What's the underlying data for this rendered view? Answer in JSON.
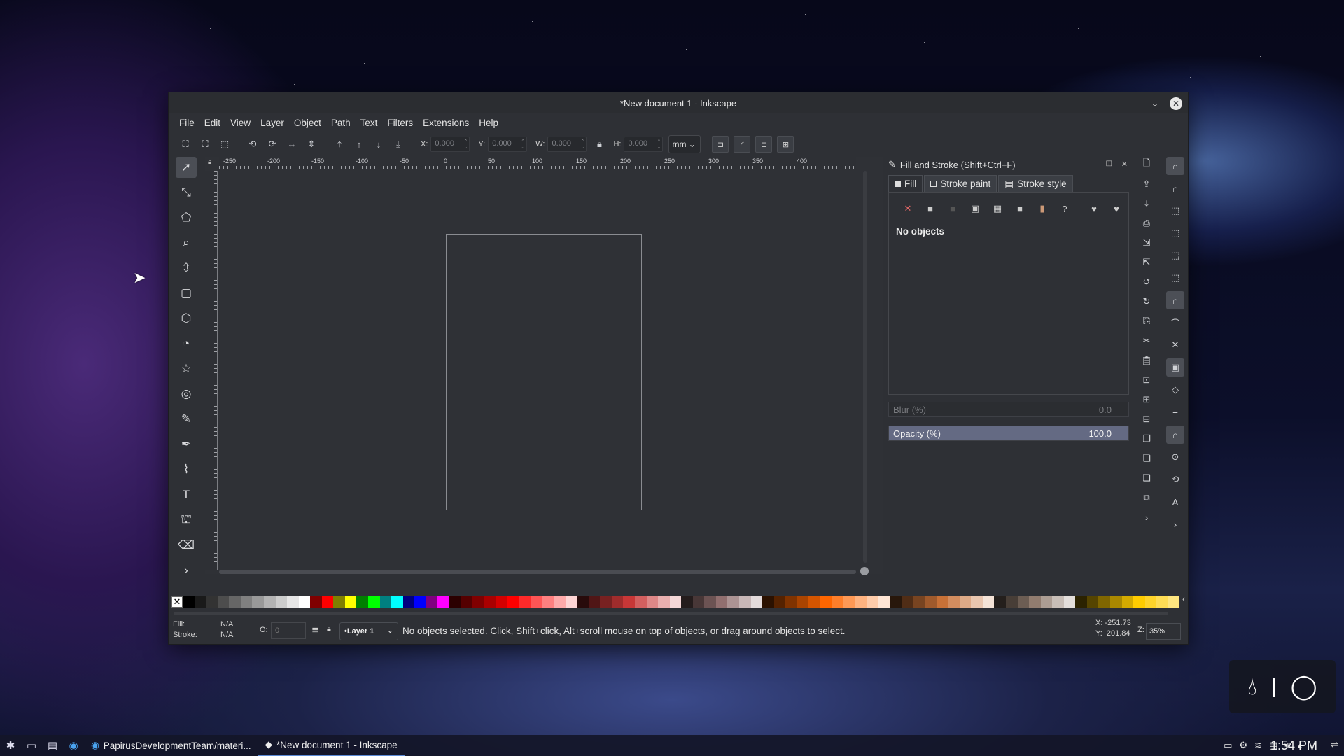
{
  "window": {
    "title": "*New document 1 - Inkscape"
  },
  "menu": [
    "File",
    "Edit",
    "View",
    "Layer",
    "Object",
    "Path",
    "Text",
    "Filters",
    "Extensions",
    "Help"
  ],
  "controls": {
    "x_label": "X:",
    "x_value": "0.000",
    "y_label": "Y:",
    "y_value": "0.000",
    "w_label": "W:",
    "w_value": "0.000",
    "h_label": "H:",
    "h_value": "0.000",
    "unit": "mm"
  },
  "ruler": {
    "h_ticks": [
      "-250",
      "-200",
      "-150",
      "-100",
      "-50",
      "0",
      "50",
      "100",
      "150",
      "200",
      "250",
      "300",
      "350",
      "400"
    ]
  },
  "tools": [
    {
      "name": "selector-tool-icon",
      "glyph": "➚"
    },
    {
      "name": "node-tool-icon",
      "glyph": "⤡"
    },
    {
      "name": "tweak-tool-icon",
      "glyph": "⬠"
    },
    {
      "name": "zoom-tool-icon",
      "glyph": "⌕"
    },
    {
      "name": "measure-tool-icon",
      "glyph": "⇳"
    },
    {
      "name": "rectangle-tool-icon",
      "glyph": "▢"
    },
    {
      "name": "3d-box-tool-icon",
      "glyph": "⬡"
    },
    {
      "name": "ellipse-tool-icon",
      "glyph": "◔"
    },
    {
      "name": "star-tool-icon",
      "glyph": "☆"
    },
    {
      "name": "spiral-tool-icon",
      "glyph": "◎"
    },
    {
      "name": "pencil-tool-icon",
      "glyph": "✎"
    },
    {
      "name": "pen-tool-icon",
      "glyph": "✒"
    },
    {
      "name": "calligraphy-tool-icon",
      "glyph": "⌇"
    },
    {
      "name": "text-tool-icon",
      "glyph": "T"
    },
    {
      "name": "spray-tool-icon",
      "glyph": "⛫"
    },
    {
      "name": "eraser-tool-icon",
      "glyph": "⌫"
    },
    {
      "name": "more-tools-icon",
      "glyph": "›"
    }
  ],
  "dock": {
    "title": "Fill and Stroke (Shift+Ctrl+F)",
    "tabs": [
      "Fill",
      "Stroke paint",
      "Stroke style"
    ],
    "no_objects": "No objects",
    "blur_label": "Blur (%)",
    "blur_value": "0.0",
    "opacity_label": "Opacity (%)",
    "opacity_value": "100.0"
  },
  "palette_colors": [
    "#000000",
    "#1a1a1a",
    "#333333",
    "#4d4d4d",
    "#666666",
    "#808080",
    "#999999",
    "#b3b3b3",
    "#cccccc",
    "#e6e6e6",
    "#ffffff",
    "#800000",
    "#ff0000",
    "#808000",
    "#ffff00",
    "#008000",
    "#00ff00",
    "#008080",
    "#00ffff",
    "#000080",
    "#0000ff",
    "#800080",
    "#ff00ff",
    "#2b0000",
    "#550000",
    "#800000",
    "#aa0000",
    "#d40000",
    "#ff0000",
    "#ff2a2a",
    "#ff5555",
    "#ff8080",
    "#ffaaaa",
    "#ffd5d5",
    "#280b0b",
    "#501616",
    "#782121",
    "#a02c2c",
    "#c83737",
    "#d35f5f",
    "#de8787",
    "#e9afaf",
    "#f4d7d7",
    "#241c1c",
    "#483737",
    "#6c5353",
    "#916f6f",
    "#ac9393",
    "#c8b7b7",
    "#e3dbdb",
    "#2b1100",
    "#552200",
    "#803300",
    "#aa4400",
    "#d45500",
    "#ff6600",
    "#ff7f2a",
    "#ff9955",
    "#ffb380",
    "#ffccaa",
    "#ffe6d5",
    "#28170b",
    "#502d16",
    "#784421",
    "#a05a2c",
    "#c87137",
    "#d38d5f",
    "#deaa87",
    "#e9c6af",
    "#f4e3d7",
    "#241f1c",
    "#483e37",
    "#6c5d53",
    "#917c6f",
    "#ac9d93",
    "#c8beb7",
    "#e3dedb",
    "#2b2200",
    "#554400",
    "#806600",
    "#aa8800",
    "#d4aa00",
    "#ffcc00",
    "#ffd42a",
    "#ffdd55",
    "#ffe680"
  ],
  "status": {
    "fill_label": "Fill:",
    "fill_value": "N/A",
    "stroke_label": "Stroke:",
    "stroke_value": "N/A",
    "o_label": "O:",
    "o_value": "0",
    "layer": "•Layer 1",
    "message": "No objects selected. Click, Shift+click, Alt+scroll mouse on top of objects, or drag around objects to select.",
    "x_coord": "X: -251.73",
    "y_coord": "Y:  201.84",
    "z_label": "Z:",
    "zoom": "35%"
  },
  "taskbar": {
    "tasks": [
      "PapirusDevelopmentTeam/materi...",
      "*New document 1 - Inkscape"
    ],
    "clock": "1:54 PM"
  }
}
